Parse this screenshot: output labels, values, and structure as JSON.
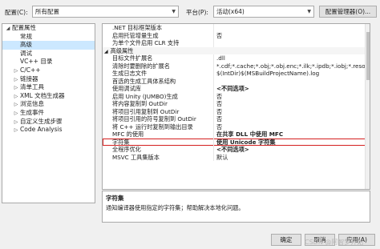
{
  "toolbar": {
    "config_label": "配置(C):",
    "config_value": "所有配置",
    "platform_label": "平台(P):",
    "platform_value": "活动(x64)",
    "config_manager_label": "配置管理器(O)..."
  },
  "tree": {
    "items": [
      {
        "label": "配置属性",
        "expander": "◢",
        "indent": 0,
        "selected": false
      },
      {
        "label": "常规",
        "expander": "",
        "indent": 1,
        "selected": false
      },
      {
        "label": "高级",
        "expander": "",
        "indent": 1,
        "selected": true
      },
      {
        "label": "调试",
        "expander": "",
        "indent": 1,
        "selected": false
      },
      {
        "label": "VC++ 目录",
        "expander": "",
        "indent": 1,
        "selected": false
      },
      {
        "label": "C/C++",
        "expander": "▷",
        "indent": 1,
        "selected": false
      },
      {
        "label": "链接器",
        "expander": "▷",
        "indent": 1,
        "selected": false
      },
      {
        "label": "清单工具",
        "expander": "▷",
        "indent": 1,
        "selected": false
      },
      {
        "label": "XML 文档生成器",
        "expander": "▷",
        "indent": 1,
        "selected": false
      },
      {
        "label": "浏览信息",
        "expander": "▷",
        "indent": 1,
        "selected": false
      },
      {
        "label": "生成事件",
        "expander": "▷",
        "indent": 1,
        "selected": false
      },
      {
        "label": "自定义生成步骤",
        "expander": "▷",
        "indent": 1,
        "selected": false
      },
      {
        "label": "Code Analysis",
        "expander": "▷",
        "indent": 1,
        "selected": false
      }
    ]
  },
  "grid": {
    "rows": [
      {
        "type": "prop",
        "name": ".NET 目标框架版本",
        "value": "",
        "bold": false,
        "highlight": false
      },
      {
        "type": "prop",
        "name": "启用托管增量生成",
        "value": "否",
        "bold": false,
        "highlight": false
      },
      {
        "type": "prop",
        "name": "为单个文件启用 CLR 支持",
        "value": "",
        "bold": false,
        "highlight": false
      },
      {
        "type": "cat",
        "name": "高级属性",
        "value": "",
        "expander": "◢",
        "bold": false,
        "highlight": false
      },
      {
        "type": "prop",
        "name": "目标文件扩展名",
        "value": ".dll",
        "bold": false,
        "highlight": false
      },
      {
        "type": "prop",
        "name": "清除时要删除的扩展名",
        "value": "*.cdf;*.cache;*.obj;*.obj.enc;*.ilk;*.ipdb;*.iobj;*.resource",
        "bold": false,
        "highlight": false
      },
      {
        "type": "prop",
        "name": "生成日志文件",
        "value": "$(IntDir)$(MSBuildProjectName).log",
        "bold": false,
        "highlight": false
      },
      {
        "type": "prop",
        "name": "首选的生成工具体系结构",
        "value": "",
        "bold": false,
        "highlight": false
      },
      {
        "type": "prop",
        "name": "使用调试库",
        "value": "<不同选项>",
        "bold": true,
        "highlight": false
      },
      {
        "type": "prop",
        "name": "启用 Unity (JUMBO)生成",
        "value": "否",
        "bold": false,
        "highlight": false
      },
      {
        "type": "prop",
        "name": "将内容复制到 OutDir",
        "value": "否",
        "bold": false,
        "highlight": false
      },
      {
        "type": "prop",
        "name": "将项目引用复制到 OutDir",
        "value": "否",
        "bold": false,
        "highlight": false
      },
      {
        "type": "prop",
        "name": "将项目引用的符号复制到 OutDir",
        "value": "否",
        "bold": false,
        "highlight": false
      },
      {
        "type": "prop",
        "name": "将 C++ 运行时复制到输出目录",
        "value": "否",
        "bold": false,
        "highlight": false
      },
      {
        "type": "prop",
        "name": "MFC 的使用",
        "value": "在共享 DLL 中使用 MFC",
        "bold": true,
        "highlight": false
      },
      {
        "type": "prop",
        "name": "字符集",
        "value": "使用 Unicode 字符集",
        "bold": true,
        "highlight": true
      },
      {
        "type": "prop",
        "name": "全程序优化",
        "value": "<不同选项>",
        "bold": true,
        "highlight": false
      },
      {
        "type": "prop",
        "name": "MSVC 工具集版本",
        "value": "默认",
        "bold": false,
        "highlight": false
      }
    ]
  },
  "description": {
    "title": "字符集",
    "text": "通知编译器使用指定的字符集；帮助解决本地化问题。"
  },
  "footer": {
    "ok_label": "确定",
    "cancel_label": "取消",
    "apply_label": "应用(A)",
    "watermark": "CSDN @阿智梦开始"
  }
}
